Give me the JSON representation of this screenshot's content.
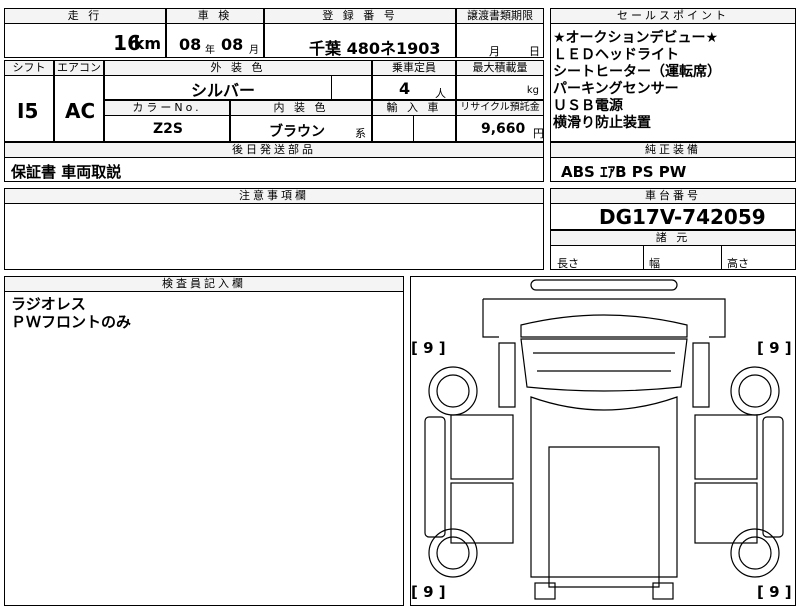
{
  "top_row": {
    "mileage_header": "走 行",
    "mileage_value": "16",
    "mileage_unit": "km",
    "inspection_header": "車 検",
    "inspection_year": "08",
    "inspection_year_unit": "年",
    "inspection_month": "08",
    "inspection_month_unit": "月",
    "registration_header": "登 録 番 号",
    "registration_value": "千葉 480ネ1903",
    "transfer_header": "譲渡書類期限",
    "transfer_month_unit": "月",
    "transfer_day_unit": "日"
  },
  "sales_points": {
    "header": "セールスポイント",
    "items": [
      "★オークションデビュー★",
      "ＬＥＤヘッドライト",
      "シートヒーター（運転席）",
      "パーキングセンサー",
      "ＵＳＢ電源",
      "横滑り防止装置"
    ]
  },
  "row2": {
    "shift_header": "シフト",
    "shift_value": "I5",
    "ac_header": "エアコン",
    "ac_value": "AC",
    "exterior_header": "外 装 色",
    "exterior_value": "シルバー",
    "capacity_header": "乗車定員",
    "capacity_value": "4",
    "capacity_unit": "人",
    "loading_header": "最大積載量",
    "loading_unit": "kg",
    "color_no_header": "カラーNo.",
    "color_no_value": "Z2S",
    "interior_header": "内 装 色",
    "interior_value": "ブラウン",
    "interior_suffix": "系",
    "import_header": "輸 入 車",
    "recycle_header": "リサイクル預託金",
    "recycle_value": "9,660",
    "recycle_unit": "円"
  },
  "later_parts": {
    "header": "後日発送部品",
    "value": "保証書 車両取説"
  },
  "genuine_equipment": {
    "header": "純正装備",
    "value": "ABS ｴｱB PS PW"
  },
  "notes": {
    "header": "注意事項欄"
  },
  "chassis": {
    "header": "車台番号",
    "value": "DG17V-742059"
  },
  "dimensions": {
    "header": "諸 元",
    "length_label": "長さ",
    "width_label": "幅",
    "height_label": "高さ"
  },
  "inspector": {
    "header": "検査員記入欄",
    "lines": [
      "ラジオレス",
      "ＰＷフロントのみ"
    ]
  },
  "diagram": {
    "tire_labels": [
      "9",
      "9",
      "9",
      "9"
    ]
  }
}
